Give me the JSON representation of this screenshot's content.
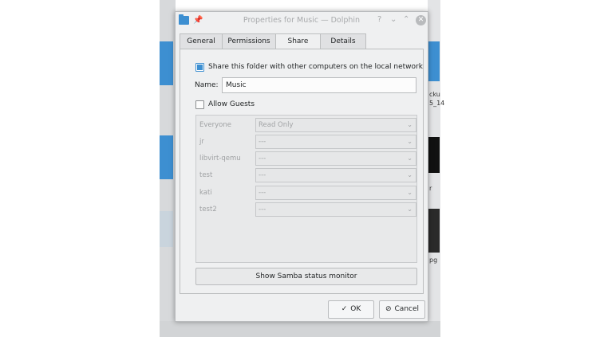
{
  "dialog": {
    "title": "Properties for Music — Dolphin",
    "help_glyph": "?",
    "minimize_glyph": "⌄",
    "maximize_glyph": "⌃",
    "close_glyph": "✕"
  },
  "tabs": [
    {
      "label": "General",
      "active": false
    },
    {
      "label": "Permissions",
      "active": false
    },
    {
      "label": "Share",
      "active": true
    },
    {
      "label": "Details",
      "active": false
    }
  ],
  "share": {
    "share_checkbox_label": "Share this folder with other computers on the local network",
    "share_checked": true,
    "name_label": "Name:",
    "name_value": "Music",
    "allow_guests_label": "Allow Guests",
    "allow_guests_checked": false,
    "permissions": [
      {
        "user": "Everyone",
        "value": "Read Only"
      },
      {
        "user": "jr",
        "value": "---"
      },
      {
        "user": "libvirt-qemu",
        "value": "---"
      },
      {
        "user": "test",
        "value": "---"
      },
      {
        "user": "kati",
        "value": "---"
      },
      {
        "user": "test2",
        "value": "---"
      }
    ],
    "samba_button": "Show Samba status monitor"
  },
  "footer": {
    "ok_label": "OK",
    "cancel_label": "Cancel"
  },
  "background": {
    "snippet1": "cku",
    "snippet2": "5_14",
    "snippet3": "r",
    "snippet4": "pg"
  },
  "colors": {
    "accent": "#3d8fd1",
    "dialog_bg": "#eff0f1"
  }
}
